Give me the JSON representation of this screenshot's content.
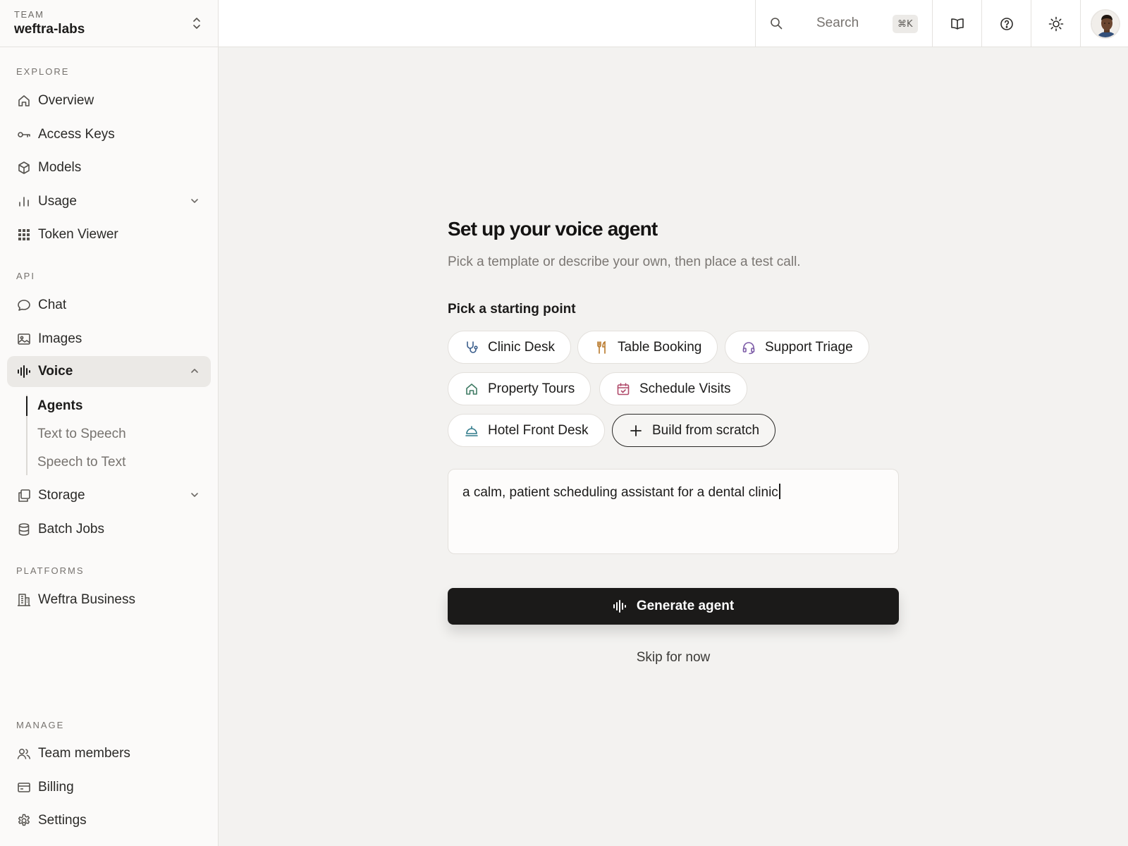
{
  "team": {
    "label": "TEAM",
    "name": "weftra-labs"
  },
  "sidebar": {
    "sections": {
      "explore": "EXPLORE",
      "api": "API",
      "platforms": "PLATFORMS",
      "manage": "MANAGE"
    },
    "explore": [
      {
        "label": "Overview",
        "icon": "home-icon"
      },
      {
        "label": "Access Keys",
        "icon": "key-icon"
      },
      {
        "label": "Models",
        "icon": "cube-icon"
      },
      {
        "label": "Usage",
        "icon": "bar-chart-icon"
      },
      {
        "label": "Token Viewer",
        "icon": "grid-icon"
      }
    ],
    "api": [
      {
        "label": "Chat",
        "icon": "chat-bubble-icon"
      },
      {
        "label": "Images",
        "icon": "image-icon"
      },
      {
        "label": "Voice",
        "icon": "waveform-icon"
      },
      {
        "label": "Storage",
        "icon": "copy-icon"
      },
      {
        "label": "Batch Jobs",
        "icon": "database-icon"
      }
    ],
    "voice_sub": [
      "Agents",
      "Text to Speech",
      "Speech to Text"
    ],
    "platforms": [
      {
        "label": "Weftra Business",
        "icon": "building-icon"
      }
    ],
    "manage": [
      {
        "label": "Team members",
        "icon": "users-icon"
      },
      {
        "label": "Billing",
        "icon": "credit-card-icon"
      },
      {
        "label": "Settings",
        "icon": "gear-icon"
      }
    ]
  },
  "topbar": {
    "search_label": "Search",
    "search_shortcut": "⌘K"
  },
  "main": {
    "title": "Set up your voice agent",
    "subtitle": "Pick a template or describe your own, then place a test call.",
    "pick_label": "Pick a starting point",
    "templates": [
      {
        "label": "Clinic Desk",
        "icon": "stethoscope-icon",
        "color": "#3b5e8c"
      },
      {
        "label": "Table Booking",
        "icon": "utensils-icon",
        "color": "#b8782a"
      },
      {
        "label": "Support Triage",
        "icon": "headset-icon",
        "color": "#7b5aa6"
      },
      {
        "label": "Property Tours",
        "icon": "home-icon",
        "color": "#3f7a63"
      },
      {
        "label": "Schedule Visits",
        "icon": "calendar-check-icon",
        "color": "#b04a6a"
      },
      {
        "label": "Hotel Front Desk",
        "icon": "service-bell-icon",
        "color": "#2f7a8a"
      }
    ],
    "build_scratch": "Build from scratch",
    "prompt_value": "a calm, patient scheduling assistant for a dental clinic",
    "generate_label": "Generate agent",
    "skip_label": "Skip for now"
  }
}
